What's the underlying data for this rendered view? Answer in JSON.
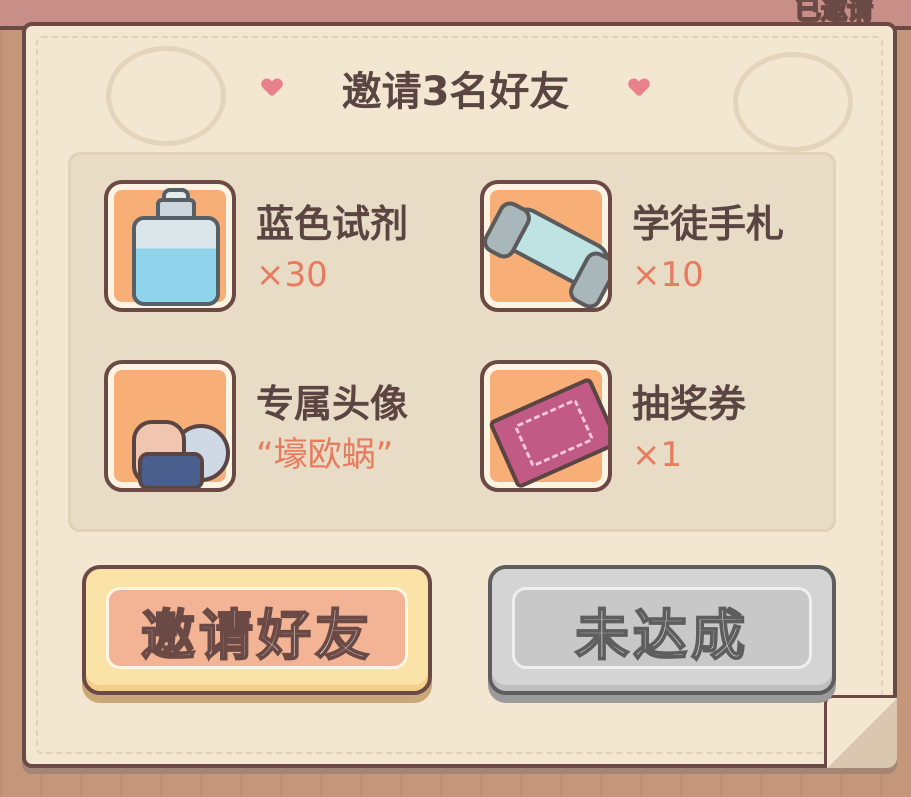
{
  "header": {
    "top_text": "已邀请"
  },
  "panel": {
    "title": "邀请3名好友"
  },
  "rewards": [
    {
      "name": "蓝色试剂",
      "qty": "×30",
      "icon": "potion-bottle-icon"
    },
    {
      "name": "学徒手札",
      "qty": "×10",
      "icon": "scroll-icon"
    },
    {
      "name": "专属头像",
      "qty": "“壕欧蜗”",
      "icon": "snail-avatar-icon"
    },
    {
      "name": "抽奖券",
      "qty": "×1",
      "icon": "lottery-ticket-icon"
    }
  ],
  "buttons": {
    "invite_label": "邀请好友",
    "status_label": "未达成"
  },
  "colors": {
    "title": "#5a4542",
    "quantity": "#e67b5e",
    "item_bg": "#f8ae77",
    "invite_button": "#f2b494",
    "disabled_button": "#c8c8c8"
  }
}
